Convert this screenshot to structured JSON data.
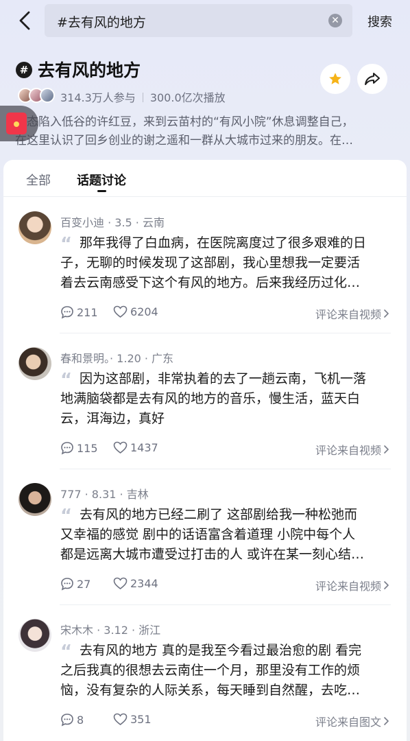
{
  "search": {
    "query": "#去有风的地方",
    "button": "搜索"
  },
  "topic": {
    "title": "去有风的地方",
    "participants": "314.3万人参与",
    "plays": "300.0亿次播放",
    "desc_line1": "状态陷入低谷的许红豆，来到云苗村的“有风小院”休息调整自己，",
    "desc_line2": "在这里认识了回乡创业的谢之遥和一群从大城市过来的朋友。在…"
  },
  "tabs": [
    {
      "label": "全部"
    },
    {
      "label": "话题讨论"
    }
  ],
  "posts": [
    {
      "meta": "百变小迪 · 3.5 · 云南",
      "lines": [
        "那年我得了白血病，在医院离度过了很多艰难的日",
        "子，无聊的时候发现了这部剧，我心里想我一定要活",
        "着去云南感受下这个有风的地方。后来我经历过化…"
      ],
      "comments": "211",
      "likes": "6204",
      "source": "评论来自视频"
    },
    {
      "meta": "春和景明。· 1.20 · 广东",
      "lines": [
        "因为这部剧，非常执着的去了一趟云南，飞机一落",
        "地满脑袋都是去有风的地方的音乐，慢生活，蓝天白",
        "云，洱海边，真好"
      ],
      "comments": "115",
      "likes": "1437",
      "source": "评论来自视频"
    },
    {
      "meta": "777 · 8.31 · 吉林",
      "lines": [
        "去有风的地方已经二刷了  这部剧给我一种松弛而",
        "又幸福的感觉  剧中的话语富含着道理  小院中每个人",
        "都是远离大城市遭受过打击的人  或许在某一刻心结…"
      ],
      "comments": "27",
      "likes": "2344",
      "source": "评论来自视频"
    },
    {
      "meta": "宋木木 · 3.12 · 浙江",
      "lines": [
        "去有风的地方  真的是我至今看过最治愈的剧  看完",
        "之后我真的很想去云南住一个月，那里没有工作的烦",
        "恼，没有复杂的人际关系，每天睡到自然醒，去吃…"
      ],
      "comments": "8",
      "likes": "351",
      "source": "评论来自图文"
    }
  ]
}
